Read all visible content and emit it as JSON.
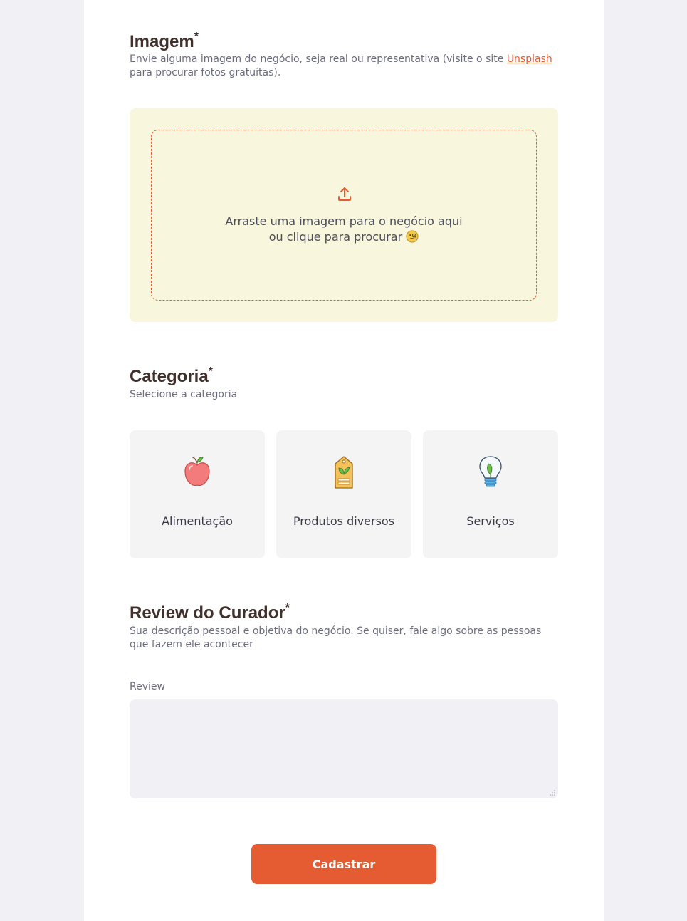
{
  "image_section": {
    "title": "Imagem",
    "required_mark": "*",
    "description_before_link": "Envie alguma imagem do negócio, seja real ou representativa (visite o site ",
    "link_text": "Unsplash",
    "description_after_link": " para procurar fotos gratuitas).",
    "dropzone": {
      "line1": "Arraste uma imagem para o negócio aqui",
      "line2": "ou clique para procurar",
      "upload_icon": "upload-icon",
      "emoji": "face-with-monocle"
    }
  },
  "category_section": {
    "title": "Categoria",
    "required_mark": "*",
    "description": "Selecione a categoria",
    "categories": [
      {
        "label": "Alimentação",
        "icon": "apple-icon"
      },
      {
        "label": "Produtos diversos",
        "icon": "tag-icon"
      },
      {
        "label": "Serviços",
        "icon": "lightbulb-icon"
      }
    ]
  },
  "review_section": {
    "title": "Review do Curador",
    "required_mark": "*",
    "description": "Sua descrição pessoal e objetiva do negócio. Se quiser, fale algo sobre as pessoas que fazem ele acontecer",
    "field_label": "Review",
    "field_value": ""
  },
  "submit": {
    "label": "Cadastrar"
  },
  "colors": {
    "accent": "#e55b32",
    "dropzone_bg": "#f8f6dd",
    "page_bg": "#f0f0f5",
    "title": "#41302b"
  }
}
